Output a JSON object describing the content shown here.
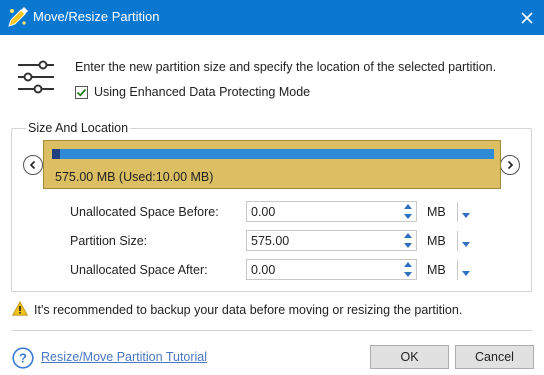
{
  "window": {
    "title": "Move/Resize Partition",
    "icons": {
      "app": "partition-wizard-icon",
      "close": "close-icon"
    }
  },
  "intro": {
    "text": "Enter the new partition size and specify the location of the selected partition.",
    "icon": "sliders-icon",
    "checkbox": {
      "label": "Using Enhanced Data Protecting Mode",
      "checked": true
    }
  },
  "size_location": {
    "legend": "Size And Location",
    "partition_label": "575.00 MB (Used:10.00 MB)",
    "used_fraction": 0.017,
    "colors": {
      "partition_fill": "#dcbf63",
      "bar": "#2f8ad5",
      "used": "#1f3f7f"
    },
    "fields": [
      {
        "label": "Unallocated Space Before:",
        "value": "0.00",
        "unit": "MB"
      },
      {
        "label": "Partition Size:",
        "value": "575.00",
        "unit": "MB"
      },
      {
        "label": "Unallocated Space After:",
        "value": "0.00",
        "unit": "MB"
      }
    ]
  },
  "warning": {
    "text": "It's recommended to backup your data before moving or resizing the partition.",
    "icon": "warning-icon"
  },
  "footer": {
    "help_link": "Resize/Move Partition Tutorial",
    "help_icon": "help-icon",
    "ok_label": "OK",
    "cancel_label": "Cancel"
  }
}
